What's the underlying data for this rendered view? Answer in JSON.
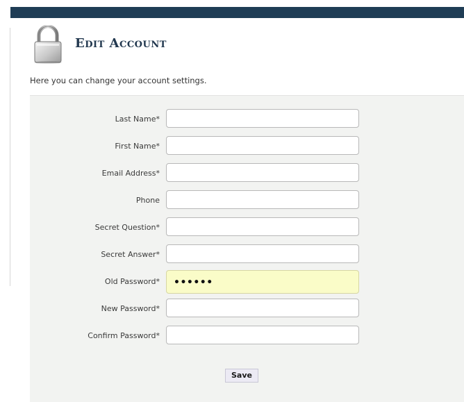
{
  "header": {
    "title": "Edit Account",
    "intro": "Here you can change your account settings."
  },
  "form": {
    "fields": [
      {
        "label": "Last Name*",
        "value": ""
      },
      {
        "label": "First Name*",
        "value": ""
      },
      {
        "label": "Email Address*",
        "value": ""
      },
      {
        "label": "Phone",
        "value": ""
      },
      {
        "label": "Secret Question*",
        "value": ""
      },
      {
        "label": "Secret Answer*",
        "value": ""
      },
      {
        "label": "Old Password*",
        "value": "••••••"
      },
      {
        "label": "New Password*",
        "value": ""
      },
      {
        "label": "Confirm Password*",
        "value": ""
      }
    ],
    "save_label": "Save"
  },
  "colors": {
    "top_bar": "#1f3d55",
    "title": "#22384f",
    "panel": "#f2f3f1",
    "autofill": "#fafcc8"
  },
  "icons": {
    "header": "padlock-icon"
  }
}
